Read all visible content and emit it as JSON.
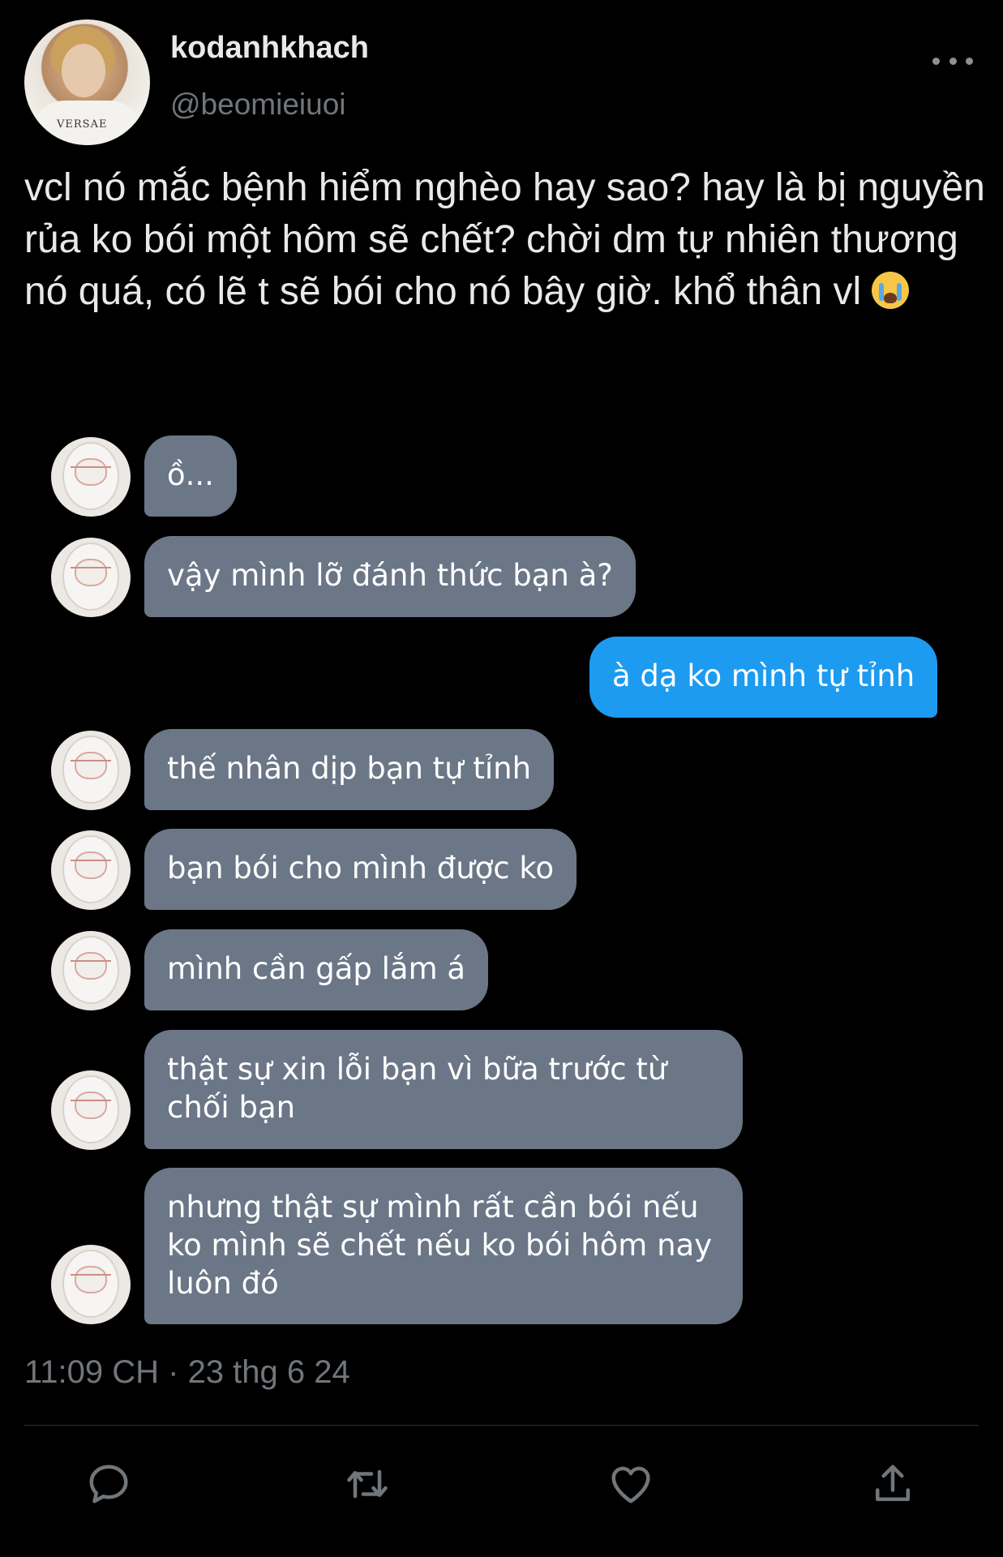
{
  "user": {
    "display_name": "kodanhkhach",
    "handle": "@beomieiuoi",
    "avatar_shirt_text": "VERSAE"
  },
  "tweet": {
    "text": "vcl nó mắc bệnh hiểm nghèo hay sao? hay là bị nguyền rủa ko bói một hôm sẽ chết? chời dm tự nhiên thương nó quá, có lẽ t sẽ bói cho nó bây giờ. khổ thân vl",
    "emoji": "loudly-crying-face",
    "timestamp": "11:09 CH · 23 thg 6 24"
  },
  "chat": {
    "messages": [
      {
        "from": "other",
        "text": "ồ..."
      },
      {
        "from": "other",
        "text": "vậy mình lỡ đánh thức bạn à?"
      },
      {
        "from": "me",
        "text": "à dạ ko mình tự tỉnh"
      },
      {
        "from": "other",
        "text": "thế nhân dịp bạn tự tỉnh"
      },
      {
        "from": "other",
        "text": "bạn bói cho mình được ko"
      },
      {
        "from": "other",
        "text": "mình cần gấp lắm á"
      },
      {
        "from": "other",
        "text": "thật sự xin lỗi bạn vì bữa trước từ chối bạn"
      },
      {
        "from": "other",
        "text": "nhưng thật sự mình rất cần bói nếu ko mình sẽ chết nếu ko bói hôm nay luôn đó"
      }
    ]
  },
  "actions": {
    "reply_icon": "reply-icon",
    "retweet_icon": "retweet-icon",
    "like_icon": "heart-icon",
    "share_icon": "share-icon"
  },
  "colors": {
    "background": "#000000",
    "other_bubble": "#6b7787",
    "my_bubble": "#1d9bf0",
    "muted_text": "#71767b",
    "icon": "#71767b"
  }
}
